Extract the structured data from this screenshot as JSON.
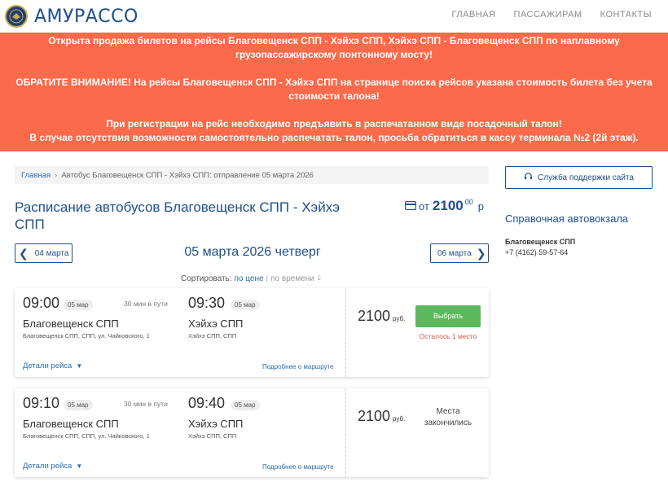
{
  "header": {
    "brand": "АМУРАССО",
    "nav": [
      "ГЛАВНАЯ",
      "ПАССАЖИРАМ",
      "КОНТАКТЫ"
    ]
  },
  "banner": {
    "lines": [
      "Открыта продажа билетов на рейсы Благовещенск СПП - Хэйхэ СПП, Хэйхэ СПП - Благовещенск СПП по наплавному грузопассажирскому понтонному мосту!",
      "ОБРАТИТЕ ВНИМАНИЕ! На рейсы Благовещенск СПП - Хэйхэ СПП на странице поиска рейсов указана стоимость билета без учета стоимости талона!",
      "При регистрации на рейс необходимо предъявить в распечатанном виде посадочный талон!",
      "В случае отсутствия возможности самостоятельно распечатать талон, просьба обратиться в кассу терминала №2 (2й этаж)."
    ]
  },
  "breadcrumb": {
    "home": "Главная",
    "current": "Автобус Благовещенск СПП - Хэйхэ СПП: отправление 05 марта 2026"
  },
  "page": {
    "title": "Расписание автобусов Благовещенск СПП - Хэйхэ СПП",
    "price_from_label": "от",
    "price_from_value": "2100",
    "price_from_sup": "00",
    "price_from_currency": "р"
  },
  "date_nav": {
    "prev": "04 марта",
    "current": "05 марта 2026 четверг",
    "next": "06 марта"
  },
  "sort": {
    "label": "Сортировать:",
    "by_price": "по цене",
    "by_time": "по времени"
  },
  "trips": [
    {
      "dep_time": "09:00",
      "dep_date": "05 мар",
      "duration": "30 мин в пути",
      "arr_time": "09:30",
      "arr_date": "05 мар",
      "dep_station": "Благовещенск СПП",
      "dep_address": "Благовещенск СПП, СПП, ул. Чайковского, 1",
      "arr_station": "Хэйхэ СПП",
      "arr_address": "Хэйхэ СПП, СПП",
      "details": "Детали рейса",
      "route_link": "Подробнее о маршруте",
      "price": "2100",
      "currency": "руб.",
      "button": "Выбрать",
      "seats_left": "Осталось 1 место"
    },
    {
      "dep_time": "09:10",
      "dep_date": "05 мар",
      "duration": "30 мин в пути",
      "arr_time": "09:40",
      "arr_date": "05 мар",
      "dep_station": "Благовещенск СПП",
      "dep_address": "Благовещенск СПП, СПП, ул. Чайковского, 1",
      "arr_station": "Хэйхэ СПП",
      "arr_address": "Хэйхэ СПП, СПП",
      "details": "Детали рейса",
      "route_link": "Подробнее о маршруте",
      "price": "2100",
      "currency": "руб.",
      "status_line1": "Места",
      "status_line2": "закончились"
    }
  ],
  "sidebar": {
    "support": "Служба поддержки сайта",
    "title": "Справочная автовокзала",
    "station": "Благовещенск СПП",
    "phone": "+7 (4162) 59-57-64"
  },
  "colors": {
    "banner": "#fb6a4a",
    "primary": "#1f4f8a",
    "link": "#2a6db5",
    "success": "#5cb85c",
    "danger": "#d9534f"
  }
}
